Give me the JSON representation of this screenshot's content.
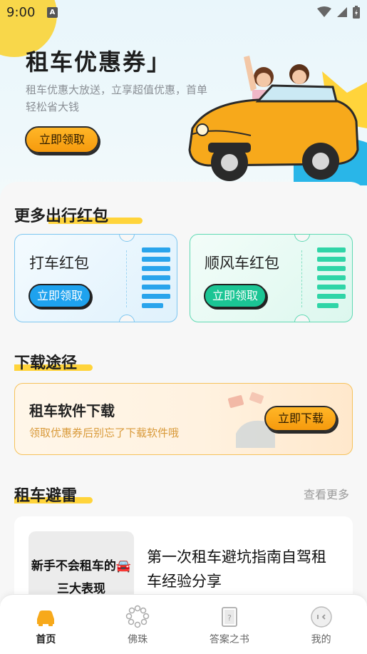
{
  "status_bar": {
    "time": "9:00",
    "notification_letter": "A"
  },
  "hero": {
    "title": "租车优惠券",
    "title_bracket": "」",
    "subtitle": "租车优惠大放送，立享超值优惠，首单轻松省大钱",
    "button": "立即领取"
  },
  "more_red_packets": {
    "title": "更多出行红包",
    "coupons": [
      {
        "name": "打车红包",
        "button": "立即领取",
        "color": "#1ea2ee"
      },
      {
        "name": "顺风车红包",
        "button": "立即领取",
        "color": "#1bc594"
      }
    ]
  },
  "download": {
    "title": "下载途径",
    "card_title": "租车软件下载",
    "card_subtitle": "领取优惠券后别忘了下载软件哦",
    "button": "立即下载"
  },
  "pitfall": {
    "title": "租车避雷",
    "more": "查看更多",
    "article": {
      "thumb_line1": "新手不会租车的🚘",
      "thumb_line2": "三大表现",
      "title": "第一次租车避坑指南自驾租车经验分享"
    }
  },
  "tabbar": {
    "items": [
      {
        "label": "首页",
        "icon": "car-icon",
        "active": true
      },
      {
        "label": "佛珠",
        "icon": "beads-icon",
        "active": false
      },
      {
        "label": "答案之书",
        "icon": "book-icon",
        "active": false
      },
      {
        "label": "我的",
        "icon": "profile-icon",
        "active": false
      }
    ]
  },
  "colors": {
    "accent_orange": "#f69a0d",
    "highlight_yellow": "#ffd43b",
    "blue": "#1ea2ee",
    "green": "#1bc594"
  }
}
